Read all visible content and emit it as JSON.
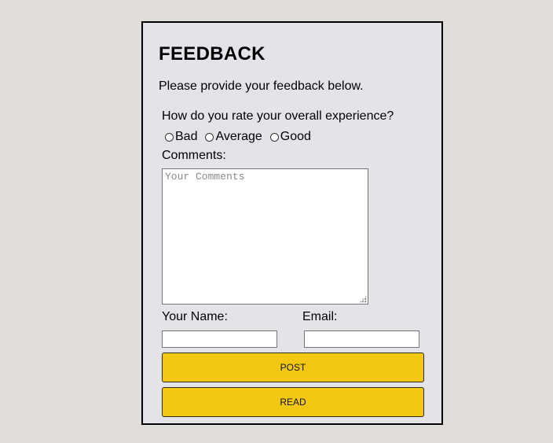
{
  "feedback": {
    "title": "FEEDBACK",
    "intro": "Please provide your feedback below.",
    "question": "How do you rate your overall experience?",
    "rating_options": [
      {
        "label": "Bad",
        "selected": false
      },
      {
        "label": "Average",
        "selected": false
      },
      {
        "label": "Good",
        "selected": false
      }
    ],
    "comments_label": "Comments:",
    "comments_placeholder": "Your Comments",
    "comments_value": "",
    "name_label": "Your Name:",
    "name_value": "",
    "email_label": "Email:",
    "email_value": "",
    "post_label": "POST",
    "read_label": "READ"
  },
  "colors": {
    "page_background": "#e0dddb",
    "card_background": "#e4e3e8",
    "button_background": "#f3c812"
  }
}
